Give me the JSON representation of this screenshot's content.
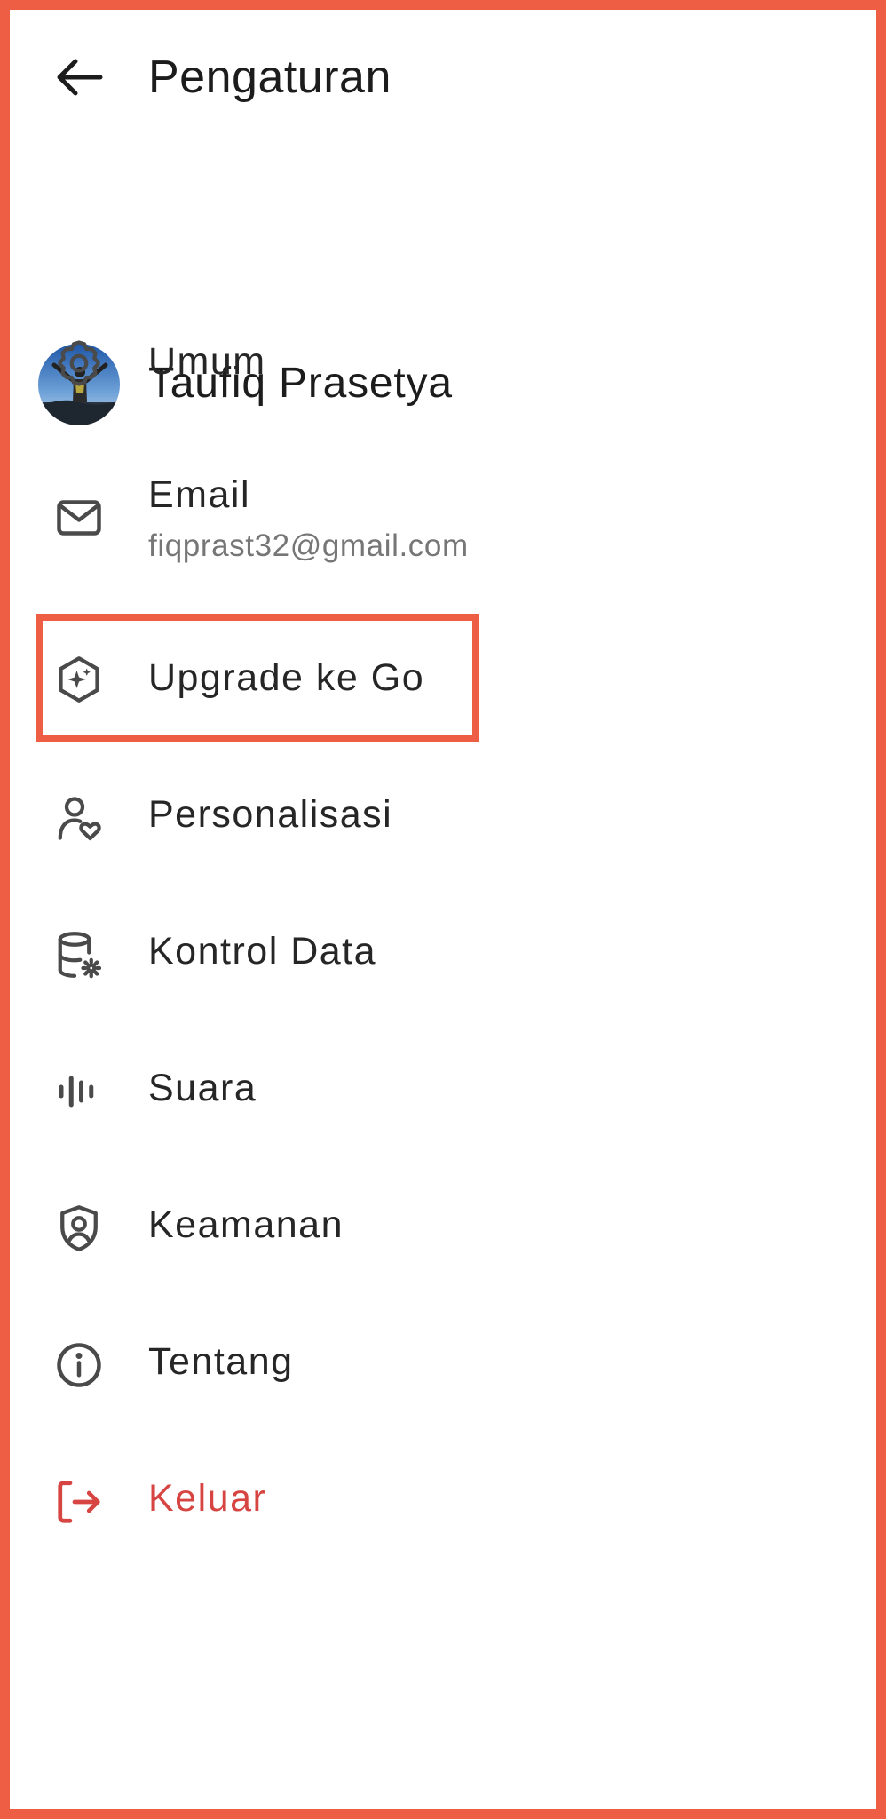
{
  "header": {
    "title": "Pengaturan",
    "back_icon": "arrow-left-icon"
  },
  "profile": {
    "name": "Taufiq Prasetya"
  },
  "menu": {
    "general": {
      "label": "Umum",
      "icon": "gear-icon"
    },
    "email": {
      "label": "Email",
      "value": "fiqprast32@gmail.com",
      "icon": "mail-icon"
    },
    "upgrade": {
      "label": "Upgrade ke Go",
      "icon": "sparkle-hexagon-icon"
    },
    "personalization": {
      "label": "Personalisasi",
      "icon": "person-heart-icon"
    },
    "data_controls": {
      "label": "Kontrol Data",
      "icon": "database-gear-icon"
    },
    "voice": {
      "label": "Suara",
      "icon": "audio-wave-icon"
    },
    "security": {
      "label": "Keamanan",
      "icon": "shield-user-icon"
    },
    "about": {
      "label": "Tentang",
      "icon": "info-icon"
    },
    "logout": {
      "label": "Keluar",
      "icon": "logout-icon"
    }
  },
  "colors": {
    "annotation_border": "#ee5e45",
    "logout": "#d64541",
    "text": "#262626",
    "secondary_text": "#767676",
    "icon": "#4a4a4a"
  }
}
